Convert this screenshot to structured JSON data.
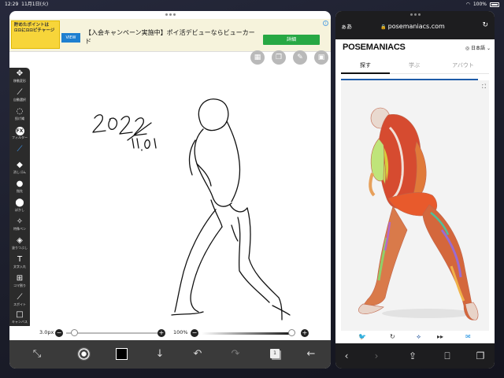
{
  "status_bar": {
    "time": "12:29",
    "date": "11月1日(火)",
    "battery": "100%"
  },
  "ad": {
    "image_text": "貯めたポイントは\n⊡⊡に⊡⊡ピチャージ",
    "logo": "VIEW",
    "text": "【入会キャンペーン実施中】ポイ活デビューならビューカード",
    "button": "詳細",
    "info_icon": "i"
  },
  "drawing": {
    "handwriting_line1": "2022",
    "handwriting_line2": "11.01"
  },
  "toolbar": {
    "items": [
      {
        "label": "移動変形",
        "icon": "move-icon"
      },
      {
        "label": "自動選択",
        "icon": "magic-wand-icon"
      },
      {
        "label": "投げ縄",
        "icon": "lasso-icon"
      },
      {
        "label": "フィルター",
        "icon": "fx-icon",
        "glyph": "FX"
      },
      {
        "label": "",
        "icon": "pen-icon"
      },
      {
        "label": "消しゴム",
        "icon": "eraser-icon"
      },
      {
        "label": "指先",
        "icon": "finger-smudge-icon"
      },
      {
        "label": "ぼかし",
        "icon": "blur-drop-icon"
      },
      {
        "label": "特殊ペン",
        "icon": "special-pen-icon"
      },
      {
        "label": "塗りつぶし",
        "icon": "fill-bucket-icon"
      },
      {
        "label": "文字入れ",
        "icon": "text-icon",
        "glyph": "T"
      },
      {
        "label": "コマ割り",
        "icon": "panel-icon"
      },
      {
        "label": "スポイト",
        "icon": "eyedropper-icon"
      },
      {
        "label": "キャンバス",
        "icon": "canvas-icon"
      }
    ]
  },
  "sliders": {
    "size_label": "3.0px",
    "opacity_label": "100%"
  },
  "bottom_bar": {
    "layer_count": "1"
  },
  "safari": {
    "aa": "ぁあ",
    "url": "posemaniacs.com"
  },
  "posemaniacs": {
    "logo": "POSEMANIACS",
    "language": "日本語",
    "tabs": [
      "探す",
      "学ぶ",
      "アバウト"
    ],
    "active_tab": 0
  },
  "colors": {
    "accent": "#3fa0ff",
    "ad_button": "#27a844",
    "progress": "#1e5ba8"
  }
}
